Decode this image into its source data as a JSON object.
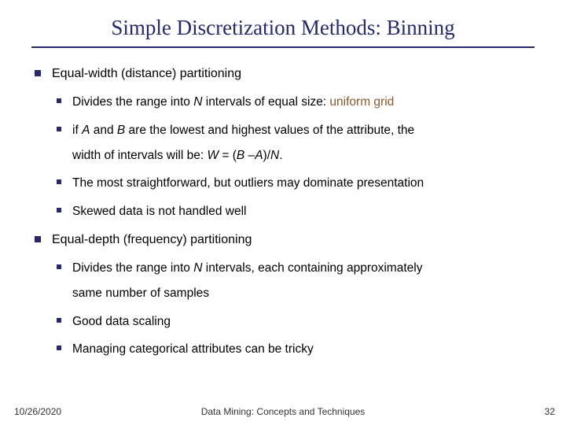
{
  "title": "Simple Discretization Methods: Binning",
  "sections": [
    {
      "heading": "Equal-width (distance) partitioning",
      "items": [
        {
          "pre": "Divides the range into ",
          "italic1": "N",
          "mid": " intervals of equal size: ",
          "highlight": "uniform grid"
        },
        {
          "pre": "if ",
          "italic1": "A",
          "mid1": " and ",
          "italic2": "B",
          "mid2": " are the lowest and highest values of the attribute, the",
          "cont_pre": "width of intervals will be: ",
          "italic3": "W",
          "mid3": " = (",
          "italic4": "B",
          "mid4": " –",
          "italic5": "A",
          "mid5": ")/",
          "italic6": "N",
          "tail": "."
        },
        {
          "text": "The most straightforward, but outliers may dominate presentation"
        },
        {
          "text": "Skewed data is not handled well"
        }
      ]
    },
    {
      "heading": "Equal-depth (frequency) partitioning",
      "items": [
        {
          "pre": "Divides the range into ",
          "italic1": "N",
          "mid": " intervals, each containing approximately",
          "cont": "same number of samples"
        },
        {
          "text": "Good data scaling"
        },
        {
          "text": "Managing categorical attributes can be tricky"
        }
      ]
    }
  ],
  "footer": {
    "date": "10/26/2020",
    "center": "Data Mining: Concepts and Techniques",
    "page": "32"
  }
}
